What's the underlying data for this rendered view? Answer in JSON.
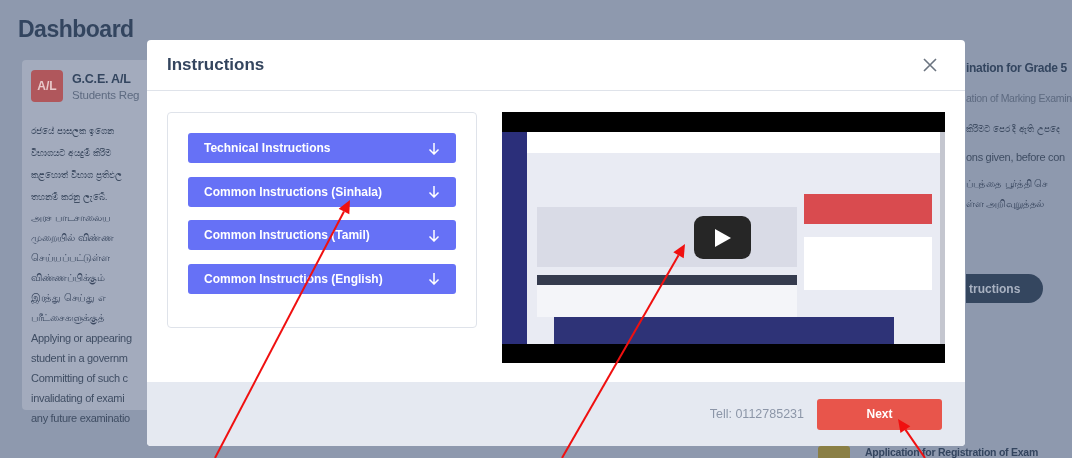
{
  "dashboard": {
    "title": "Dashboard",
    "left_card": {
      "badge": "A/L",
      "title": "G.C.E. A/L",
      "subtitle": "Students Reg",
      "lines": [
        {
          "kind": "sinhala",
          "text": "රජයේ පාසලක ඉගෙන"
        },
        {
          "kind": "sinhala",
          "text": "විභාගයට අයදුම් කිරීම"
        },
        {
          "kind": "sinhala",
          "text": "කළහොත් විභාග ප්‍රතිඵල"
        },
        {
          "kind": "sinhala",
          "text": "තහනම් කරනු ලැබේ."
        },
        {
          "kind": "tamil",
          "text": "அரச பாடசாலைய"
        },
        {
          "kind": "tamil",
          "text": "முறையில் விண்ண"
        },
        {
          "kind": "tamil",
          "text": "செய்யப்பட்டுள்ள"
        },
        {
          "kind": "tamil",
          "text": "விண்ணப்பிக்கும்"
        },
        {
          "kind": "tamil",
          "text": "இரத்து செய்து எ"
        },
        {
          "kind": "tamil",
          "text": "பரீட்சைகளுக்குத்"
        },
        {
          "kind": "english",
          "text": "Applying or appearing"
        },
        {
          "kind": "english",
          "text": "student in a governm"
        },
        {
          "kind": "english",
          "text": "Committing of such c"
        },
        {
          "kind": "english",
          "text": "invalidating of exami"
        },
        {
          "kind": "english",
          "text": "any future examinatio"
        }
      ]
    },
    "right_card": {
      "title": "ination for Grade 5",
      "subtitle": "ation of Marking Examin",
      "lines": [
        {
          "kind": "sinhala",
          "text": "කිරීමට පෙර දී ඇති උපදෙ"
        },
        {
          "kind": "english",
          "text": "ons given, before con"
        },
        {
          "kind": "tamil",
          "text": "ப்பத்தை பூர்த்தி செ"
        },
        {
          "kind": "tamil",
          "text": "ள்ள அறிவுறுத்தல்"
        }
      ],
      "button": "tructions"
    },
    "next_card": {
      "title": "Application for Registration of Exam"
    }
  },
  "modal": {
    "title": "Instructions",
    "sections": [
      {
        "label": "Technical Instructions"
      },
      {
        "label": "Common Instructions (Sinhala)"
      },
      {
        "label": "Common Instructions (Tamil)"
      },
      {
        "label": "Common Instructions (English)"
      }
    ],
    "contact": "Tell: 0112785231",
    "next_button": "Next"
  },
  "annotations": [
    {
      "kind": "arrow"
    },
    {
      "kind": "arrow"
    },
    {
      "kind": "arrow"
    }
  ]
}
